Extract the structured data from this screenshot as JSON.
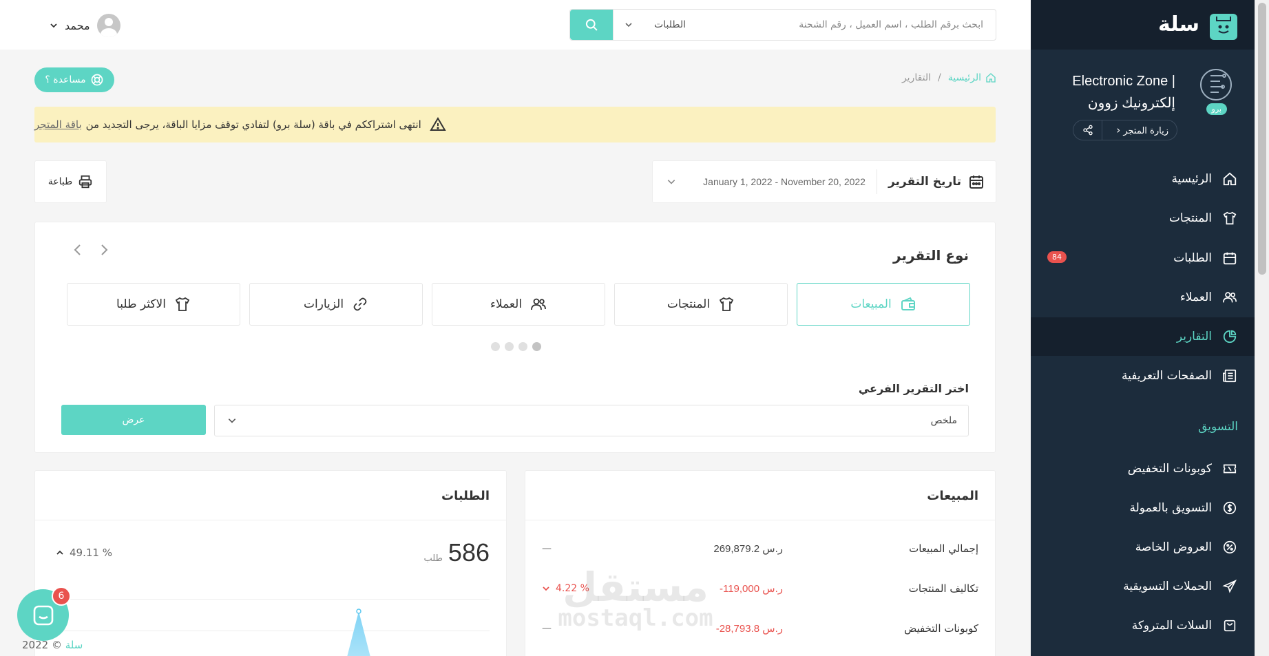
{
  "sidebar": {
    "logo_text": "سلة",
    "store_name": "Electronic Zone | إلكترونيك زوون",
    "badge": "برو",
    "visit_label": "زيارة المتجر",
    "items": [
      {
        "label": "الرئيسية",
        "icon": "home-icon"
      },
      {
        "label": "المنتجات",
        "icon": "shirt-icon"
      },
      {
        "label": "الطلبات",
        "icon": "calendar-icon",
        "badge": "84"
      },
      {
        "label": "العملاء",
        "icon": "users-icon"
      },
      {
        "label": "التقارير",
        "icon": "pie-chart-icon"
      },
      {
        "label": "الصفحات التعريفية",
        "icon": "newspaper-icon"
      }
    ],
    "marketing_label": "التسويق",
    "marketing_items": [
      {
        "label": "كوبونات التخفيض",
        "icon": "ticket-icon"
      },
      {
        "label": "التسويق بالعمولة",
        "icon": "dollar-icon"
      },
      {
        "label": "العروض الخاصة",
        "icon": "discount-icon"
      },
      {
        "label": "الحملات التسويقية",
        "icon": "send-icon"
      },
      {
        "label": "السلات المتروكة",
        "icon": "cart-icon"
      }
    ]
  },
  "header": {
    "search_placeholder": "ابحث برقم الطلب ، اسم العميل ، رقم الشحنة",
    "search_scope": "الطلبات",
    "user_name": "محمد"
  },
  "breadcrumb": {
    "home": "الرئيسية",
    "sep": "/",
    "current": "التقارير"
  },
  "help_label": "مساعدة ؟",
  "alert": {
    "text": "انتهى اشتراككم في باقة (سلة برو) لتفادي توقف مزايا الباقة، يرجى التجديد من",
    "link": "باقة المتجر"
  },
  "date_filter": {
    "label": "تاريخ التقرير",
    "range": "January 1, 2022 - November 20, 2022"
  },
  "print_label": "طباعة",
  "report": {
    "title": "نوع التقرير",
    "tabs": [
      {
        "label": "المبيعات",
        "icon": "wallet-icon",
        "active": true
      },
      {
        "label": "المنتجات",
        "icon": "shirt-icon",
        "active": false
      },
      {
        "label": "العملاء",
        "icon": "users-icon",
        "active": false
      },
      {
        "label": "الزيارات",
        "icon": "link-icon",
        "active": false
      },
      {
        "label": "الاكثر طلبا",
        "icon": "shirt-icon",
        "active": false
      }
    ],
    "sub_label": "اختر التقرير الفرعي",
    "sub_value": "ملخص",
    "view_label": "عرض"
  },
  "sales": {
    "title": "المبيعات",
    "rows": [
      {
        "name": "إجمالي المبيعات",
        "value": "269,879.2 ر.س",
        "change": "—",
        "negative": false
      },
      {
        "name": "تكاليف المنتجات",
        "value": "-119,000 ر.س",
        "change": "4.22 %",
        "negative": true
      },
      {
        "name": "كوبونات التخفيض",
        "value": "-28,793.8 ر.س",
        "change": "—",
        "negative": true
      }
    ]
  },
  "orders": {
    "title": "الطلبات",
    "count": "586",
    "unit": "طلب",
    "change": "49.11 %"
  },
  "chat_badge": "6",
  "footer": {
    "brand": "سلة",
    "copy": "© 2022"
  },
  "watermark": {
    "main": "مستقل",
    "sub": "mostaql.com"
  },
  "colors": {
    "accent": "#5dd5c4",
    "sidebar": "#1c2c3c",
    "danger": "#e9524e",
    "alert_bg": "#fbf1c0"
  }
}
